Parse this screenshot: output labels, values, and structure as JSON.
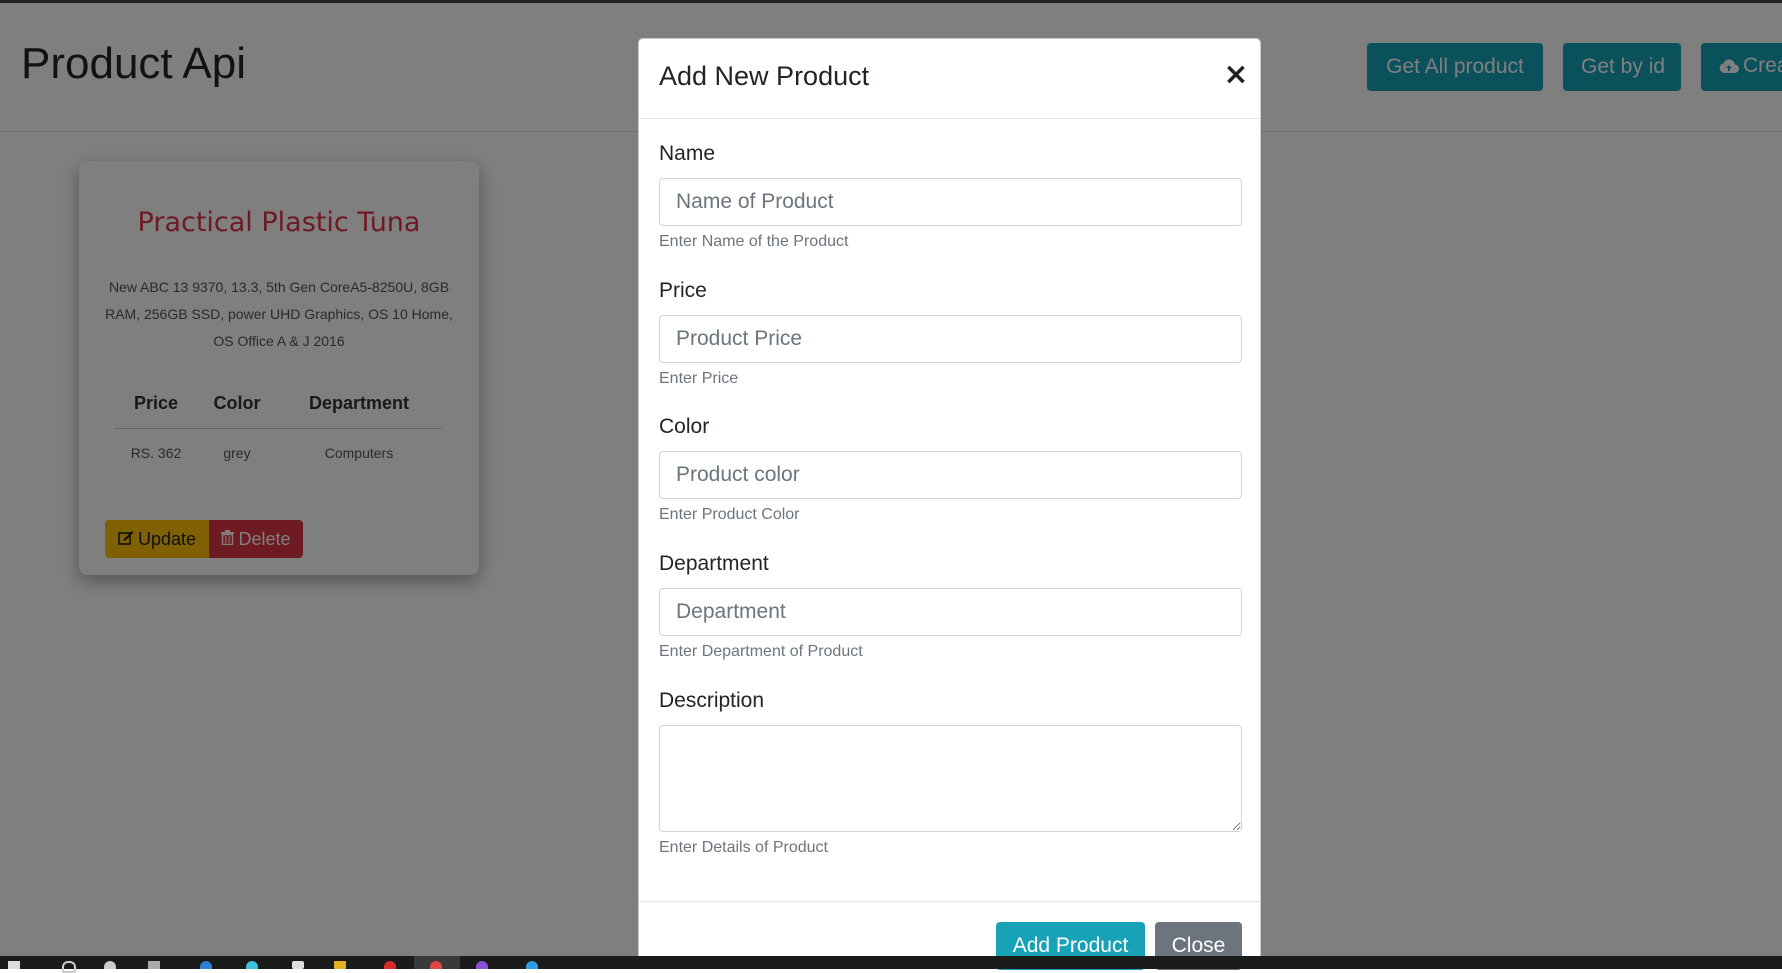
{
  "page": {
    "title": "Product Api",
    "buttons": [
      "Get All product",
      "Get by id",
      "Crea"
    ]
  },
  "card": {
    "title": "Practical Plastic Tuna",
    "description": "New ABC 13 9370, 13.3, 5th Gen CoreA5-8250U, 8GB RAM, 256GB SSD, power UHD Graphics, OS 10 Home, OS Office A & J 2016",
    "table": {
      "headers": [
        "Price",
        "Color",
        "Department"
      ],
      "row": [
        "RS. 362",
        "grey",
        "Computers"
      ]
    },
    "update_label": "Update",
    "delete_label": "Delete"
  },
  "modal": {
    "title": "Add New Product",
    "close_symbol": "×",
    "fields": [
      {
        "label": "Name",
        "placeholder": "Name of Product",
        "help": "Enter Name of the Product"
      },
      {
        "label": "Price",
        "placeholder": "Product Price",
        "help": "Enter Price"
      },
      {
        "label": "Color",
        "placeholder": "Product color",
        "help": "Enter Product Color"
      },
      {
        "label": "Department",
        "placeholder": "Department",
        "help": "Enter Department of Product"
      }
    ],
    "description": {
      "label": "Description",
      "help": "Enter Details of Product"
    },
    "add_label": "Add Product",
    "close_label": "Close"
  },
  "colors": {
    "info": "#17a2b8",
    "warning": "#ffc107",
    "danger": "#dc3545",
    "secondary": "#6c757d"
  },
  "icons": {
    "create_button": "cloud-upload-icon",
    "update_button": "edit-icon",
    "delete_button": "trash-icon"
  }
}
